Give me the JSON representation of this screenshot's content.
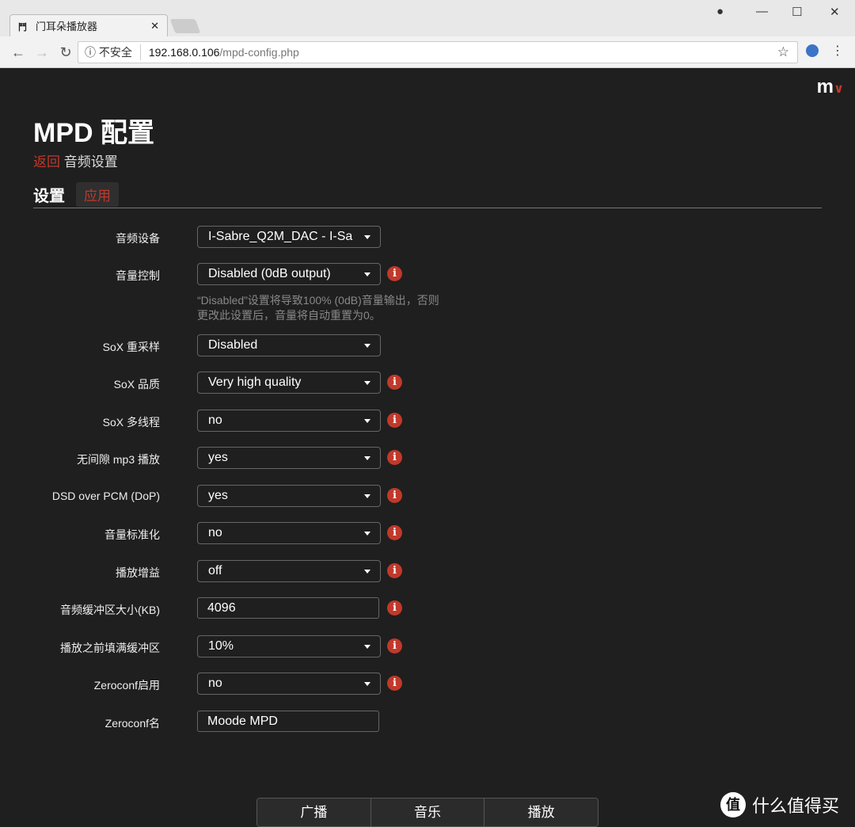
{
  "browser": {
    "tab_title": "门耳朵播放器",
    "url_security": "不安全",
    "url_host": "192.168.0.106",
    "url_path": "/mpd-config.php"
  },
  "logo": "m",
  "page": {
    "title": "MPD 配置",
    "back": "返回",
    "crumb": "音频设置",
    "section": "设置",
    "apply": "应用",
    "help": [
      "“Disabled”设置将导致100% (0dB)音量输出，否则",
      "更改此设置后，音量将自动重置为0。"
    ]
  },
  "rows": [
    {
      "label": "音频设备",
      "value": "I-Sabre_Q2M_DAC - I-Sa",
      "type": "select",
      "info": false
    },
    {
      "label": "音量控制",
      "value": "Disabled (0dB output)",
      "type": "select",
      "info": true
    },
    {
      "label": "SoX 重采样",
      "value": "Disabled",
      "type": "select",
      "info": false
    },
    {
      "label": "SoX 品质",
      "value": "Very high quality",
      "type": "select",
      "info": true
    },
    {
      "label": "SoX 多线程",
      "value": "no",
      "type": "select",
      "info": true
    },
    {
      "label": "无间隙 mp3 播放",
      "value": "yes",
      "type": "select",
      "info": true
    },
    {
      "label": "DSD over PCM (DoP)",
      "value": "yes",
      "type": "select",
      "info": true
    },
    {
      "label": "音量标准化",
      "value": "no",
      "type": "select",
      "info": true
    },
    {
      "label": "播放增益",
      "value": "off",
      "type": "select",
      "info": true
    },
    {
      "label": "音频缓冲区大小(KB)",
      "value": "4096",
      "type": "text",
      "info": true
    },
    {
      "label": "播放之前填满缓冲区",
      "value": "10%",
      "type": "select",
      "info": true
    },
    {
      "label": "Zeroconf启用",
      "value": "no",
      "type": "select",
      "info": true
    },
    {
      "label": "Zeroconf名",
      "value": "Moode MPD",
      "type": "text",
      "info": false
    }
  ],
  "bottom_nav": [
    "广播",
    "音乐",
    "播放"
  ],
  "watermark": "什么值得买",
  "accent": "#c0392b"
}
